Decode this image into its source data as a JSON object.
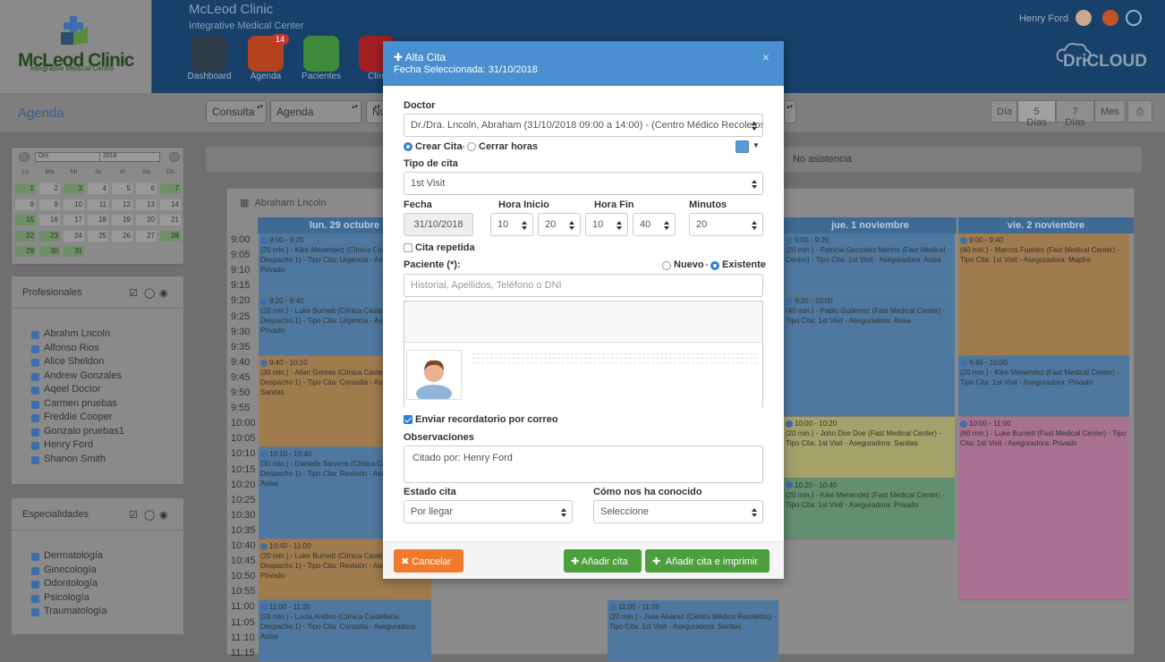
{
  "header": {
    "clinic": "McLeod Clinic",
    "subtitle": "Integrative Medical Center",
    "logo_title": "McLeod Clinic",
    "logo_sub": "Integrative Medical Centre",
    "user": "Henry Ford",
    "brand": "DriCLOUD",
    "nav": [
      {
        "label": "Dashboard",
        "color": "#2f3b46"
      },
      {
        "label": "Agenda",
        "color": "#b4421e",
        "badge": "14"
      },
      {
        "label": "Pacientes",
        "color": "#3c8a3a"
      },
      {
        "label": "Clíni",
        "color": "#a11f23"
      }
    ]
  },
  "toolbar": {
    "title": "Agenda",
    "consulta": "Consulta",
    "agenda": "Agenda",
    "nu": "Nu",
    "views": [
      "Día",
      "5 Días",
      "7 Días",
      "Mes"
    ]
  },
  "calendar": {
    "month": "Oct",
    "year": "2018",
    "dow": [
      "Lu",
      "Ma",
      "Mi",
      "Ju",
      "Vi",
      "Sá",
      "Do"
    ],
    "days": [
      [
        1,
        2,
        3,
        4,
        5,
        6,
        7
      ],
      [
        8,
        9,
        10,
        11,
        12,
        13,
        14
      ],
      [
        15,
        16,
        17,
        18,
        19,
        20,
        21
      ],
      [
        22,
        23,
        24,
        25,
        26,
        27,
        28
      ],
      [
        29,
        30,
        31
      ]
    ],
    "green": [
      1,
      3,
      7,
      15,
      22,
      23,
      28,
      29,
      30,
      31
    ]
  },
  "profesionales": {
    "title": "Profesionales",
    "items": [
      "Abrahm Lncoln",
      "Alfonso Rios",
      "Alice Sheldon",
      "Andrew Gonzales",
      "Aqeel Doctor",
      "Carmen pruebas",
      "Freddie Cooper",
      "Gonzalo pruebas1",
      "Henry Ford",
      "Shanon Smith"
    ]
  },
  "especialidades": {
    "title": "Especialidades",
    "items": [
      "Dermatología",
      "Ginecología",
      "Odontología",
      "Psicología",
      "Traumatología"
    ]
  },
  "agenda_view": {
    "no_asistencia": "No asistencia",
    "doctor": "Abraham Lncoln",
    "days": [
      "lun. 29 octubre",
      "jue. 1 noviembre",
      "vie. 2 noviembre"
    ],
    "times": [
      "9:00",
      "9:05",
      "9:10",
      "9:15",
      "9:20",
      "9:25",
      "9:30",
      "9:35",
      "9:40",
      "9:45",
      "9:50",
      "9:55",
      "10:00",
      "10:05",
      "10:10",
      "10:15",
      "10:20",
      "10:25",
      "10:30",
      "10:35",
      "10:40",
      "10:45",
      "10:50",
      "10:55",
      "11:00",
      "11:05",
      "11:10",
      "11:15"
    ],
    "events_mon": [
      {
        "t": "9:00 - 9:20",
        "d": "(20 min.) - Kike Menendez (Clínica Castellana. Despacho 1) - Tipo Cita: Urgencia - Aseguradora: Privado"
      },
      {
        "t": "9:20 - 9:40",
        "d": "(20 min.) - Luke Burnett (Clínica Castellana. Despacho 1) - Tipo Cita: Urgencia - Aseguradora: Privado"
      },
      {
        "t": "9:40 - 10:10",
        "d": "(30 min.) - Allan Grimes (Clínica Castellana. Despacho 1) - Tipo Cita: Consulta - Aseguradora: Sanitas"
      },
      {
        "t": "10:10 - 10:40",
        "d": "(30 min.) - Danielle Stevens (Clínica Castellana. Despacho 1) - Tipo Cita: Revisión - Aseguradora: Asisa"
      },
      {
        "t": "10:40 - 11:00",
        "d": "(20 min.) - Luke Burnett (Clínica Castellana. Despacho 1) - Tipo Cita: Revisión - Aseguradora: Privado"
      },
      {
        "t": "11:00 - 11:20",
        "d": "(20 min.) - Lucía Andino (Clínica Castellana. Despacho 1) - Tipo Cita: Consulta - Aseguradora: Asisa"
      }
    ],
    "events_wed": [
      {
        "t": "11:00 - 11:20",
        "d": "(20 min.) - Jose Alvarez (Centro Médico Recoletos) - Tipo Cita: 1st Visit - Aseguradora: Sanitas"
      }
    ],
    "events_thu": [
      {
        "t": "9:00 - 9:20",
        "d": "(20 min.) - Patricia Gonzalez Merino (Fast Medical Center) - Tipo Cita: 1st Visit - Aseguradora: Asisa"
      },
      {
        "t": "9:20 - 10:00",
        "d": "(40 min.) - Pablo Gutierrez (Fast Medical Center) - Tipo Cita: 1st Visit - Aseguradora: Asisa"
      },
      {
        "t": "10:00 - 10:20",
        "d": "(20 min.) - John Doe Doe (Fast Medical Center) - Tipo Cita: 1st Visit - Aseguradora: Sanitas"
      },
      {
        "t": "10:20 - 10:40",
        "d": "(20 min.) - Kike Menendez (Fast Medical Center) - Tipo Cita: 1st Visit - Aseguradora: Privado"
      }
    ],
    "events_fri": [
      {
        "t": "9:00 - 9:40",
        "d": "(40 min.) - Marcos Fuertes (Fast Medical Center) - Tipo Cita: 1st Visit - Aseguradora: Mapfre"
      },
      {
        "t": "9:40 - 10:00",
        "d": "(20 min.) - Kike Menendez (Fast Medical Center) - Tipo Cita: 1st Visit - Aseguradora: Privado"
      },
      {
        "t": "10:00 - 11:00",
        "d": "(60 min.) - Luke Burnett (Fast Medical Center) - Tipo Cita: 1st Visit - Aseguradora: Privado"
      }
    ]
  },
  "modal": {
    "title": "Alta Cita",
    "subtitle": "Fecha Seleccionada: 31/10/2018",
    "close": "×",
    "doctor_label": "Doctor",
    "doctor_value": "Dr./Dra. Lncoln, Abraham (31/10/2018 09:00 a 14:00) - (Centro Médico Recoletos",
    "crear": "Crear Cita",
    "sep": "-",
    "cerrar": "Cerrar horas",
    "color": "#5b9bd5",
    "tipo_label": "Tipo de cita",
    "tipo_value": "1st Visit",
    "fecha_label": "Fecha",
    "fecha_value": "31/10/2018",
    "hi_label": "Hora Inicio",
    "hi_h": "10",
    "hi_m": "20",
    "hf_label": "Hora Fin",
    "hf_h": "10",
    "hf_m": "40",
    "min_label": "Minutos",
    "min_value": "20",
    "repetida": "Cita repetida",
    "paciente_label": "Paciente (*):",
    "nuevo": "Nuevo",
    "existente": "Existente",
    "search_placeholder": "Historial, Apellidos, Teléfono o DNI",
    "recordatorio": "Enviar recordatorio por correo",
    "obs_label": "Observaciones",
    "obs_value": "Citado por: Henry Ford",
    "estado_label": "Estado cita",
    "estado_value": "Por llegar",
    "conocido_label": "Cómo nos ha conocido",
    "conocido_value": "Seleccione",
    "cancel": "Cancelar",
    "add": "Añadir cita",
    "add_print": "Añadir cita e imprimir"
  }
}
